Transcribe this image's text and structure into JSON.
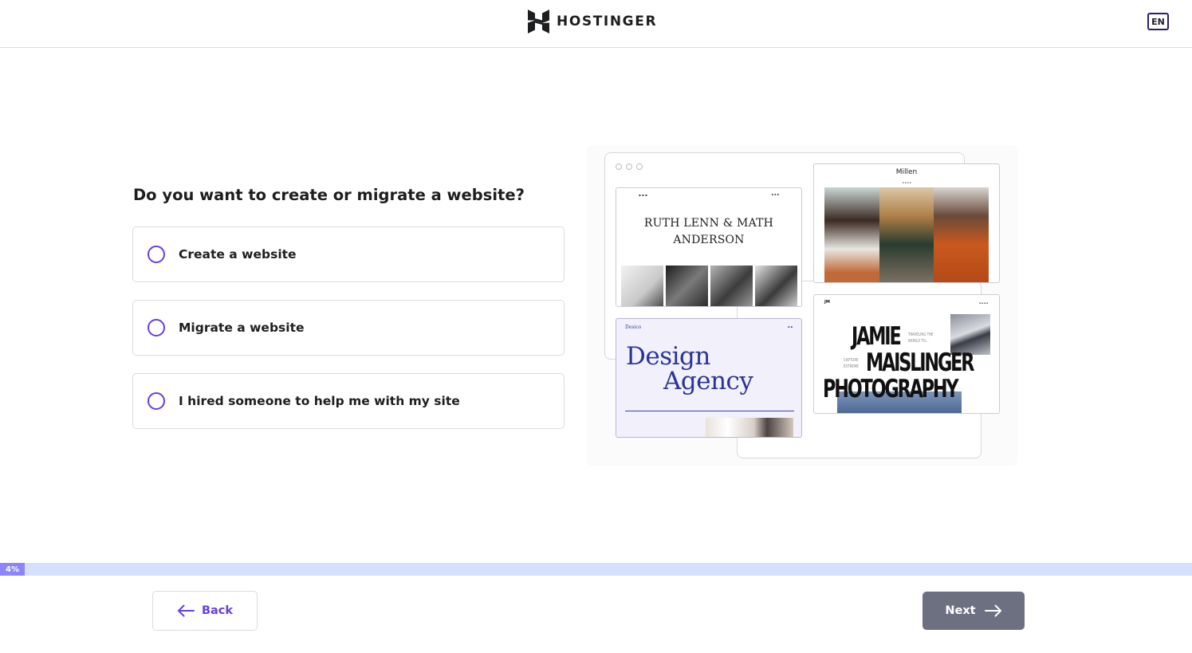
{
  "header": {
    "brand": "HOSTINGER",
    "language": "EN"
  },
  "question": "Do you want to create or migrate a website?",
  "options": [
    {
      "label": "Create a website",
      "selected": false
    },
    {
      "label": "Migrate a website",
      "selected": false
    },
    {
      "label": "I hired someone to help me with my site",
      "selected": false
    }
  ],
  "illustration": {
    "card_ruth": {
      "title_line1": "RUTH LENN & MATH",
      "title_line2": "ANDERSON"
    },
    "card_millen": {
      "title": "Millen"
    },
    "card_design": {
      "title_line1": "Design",
      "title_line2": "Agency"
    },
    "card_jamie": {
      "line1": "JAMIE",
      "line2": "MAISLINGER",
      "line3": "PHOTOGRAPHY",
      "tag1": "TRAVELING THE WORLD TO...",
      "tag2": "CAPTURE EXTREME"
    }
  },
  "progress": {
    "value_percent": 4,
    "label": "4%"
  },
  "footer": {
    "back_label": "Back",
    "next_label": "Next"
  },
  "colors": {
    "accent": "#673de6",
    "progress_fill": "#8c85ff",
    "progress_track": "#d5dfff",
    "next_button": "#6d7081"
  },
  "icons": [
    "hostinger-logo-icon",
    "arrow-left-icon",
    "arrow-right-icon"
  ]
}
